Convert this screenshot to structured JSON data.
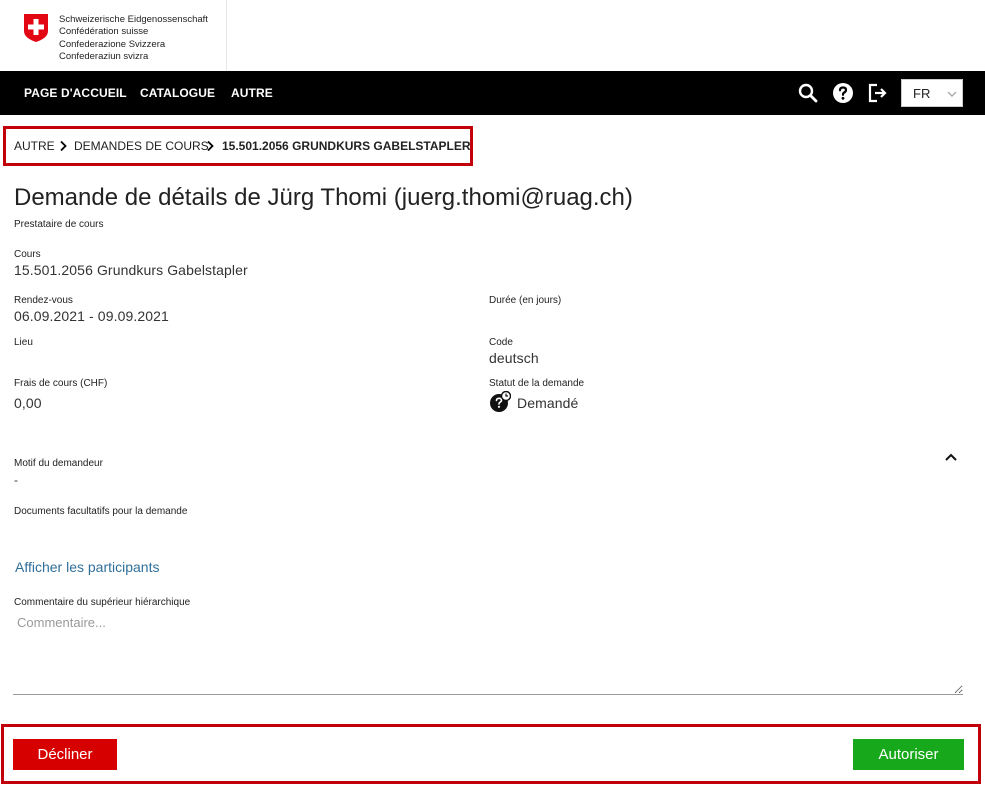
{
  "header": {
    "gov_lines": [
      "Schweizerische Eidgenossenschaft",
      "Confédération suisse",
      "Confederazione Svizzera",
      "Confederaziun svizra"
    ],
    "nav": {
      "home": "PAGE D'ACCUEIL",
      "catalogue": "CATALOGUE",
      "other": "AUTRE"
    },
    "icons": [
      "search-icon",
      "help-icon",
      "logout-icon"
    ],
    "language": "FR"
  },
  "breadcrumb": {
    "item1": "AUTRE",
    "item2": "DEMANDES DE COURS",
    "current": "15.501.2056 GRUNDKURS GABELSTAPLER"
  },
  "page": {
    "title": "Demande de détails de Jürg Thomi (juerg.thomi@ruag.ch)",
    "provider_label": "Prestataire de cours"
  },
  "details": {
    "course_label": "Cours",
    "course_value": "15.501.2056 Grundkurs Gabelstapler",
    "dates_label": "Rendez-vous",
    "dates_value": "06.09.2021 - 09.09.2021",
    "duration_label": "Durée (en jours)",
    "location_label": "Lieu",
    "code_label": "Code",
    "code_value": "deutsch",
    "fees_label": "Frais de cours (CHF)",
    "fees_value": "0,00",
    "status_label": "Statut de la demande",
    "status_value": "Demandé",
    "reason_label": "Motif du demandeur",
    "reason_value": "-",
    "documents_label": "Documents facultatifs pour la demande",
    "participants_link": "Afficher les participants",
    "comment_label": "Commentaire du supérieur hiérarchique",
    "comment_placeholder": "Commentaire..."
  },
  "actions": {
    "decline": "Décliner",
    "authorize": "Autoriser"
  },
  "colors": {
    "navbar": "#000000",
    "highlight": "#c2000b",
    "decline": "#d60000",
    "authorize": "#18a81c",
    "link": "#2f6f9a"
  }
}
